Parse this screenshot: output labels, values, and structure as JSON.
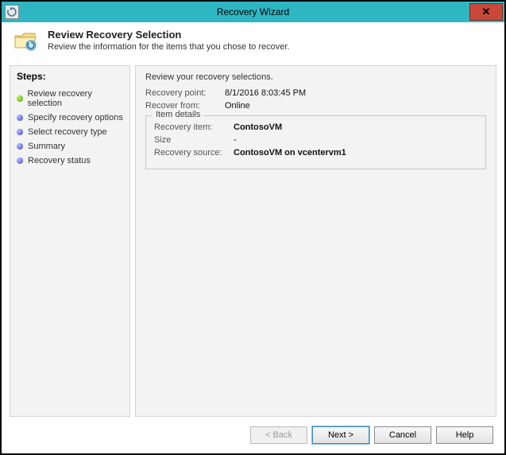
{
  "window": {
    "title": "Recovery Wizard",
    "close_symbol": "✕"
  },
  "header": {
    "title": "Review Recovery Selection",
    "subtitle": "Review the information for the items that you chose to recover."
  },
  "steps": {
    "heading": "Steps:",
    "items": [
      {
        "label": "Review recovery selection",
        "status": "active"
      },
      {
        "label": "Specify recovery options",
        "status": "pending"
      },
      {
        "label": "Select recovery type",
        "status": "pending"
      },
      {
        "label": "Summary",
        "status": "pending"
      },
      {
        "label": "Recovery status",
        "status": "pending"
      }
    ]
  },
  "main": {
    "review_prompt": "Review your recovery selections.",
    "recovery_point": {
      "label": "Recovery point:",
      "value": "8/1/2016 8:03:45 PM"
    },
    "recover_from": {
      "label": "Recover from:",
      "value": "Online"
    },
    "item_details": {
      "legend": "Item details",
      "recovery_item": {
        "label": "Recovery item:",
        "value": "ContosoVM"
      },
      "size": {
        "label": "Size",
        "value": "-"
      },
      "recovery_source": {
        "label": "Recovery source:",
        "value": "ContosoVM on vcentervm1"
      }
    }
  },
  "buttons": {
    "back": "< Back",
    "next": "Next >",
    "cancel": "Cancel",
    "help": "Help"
  }
}
